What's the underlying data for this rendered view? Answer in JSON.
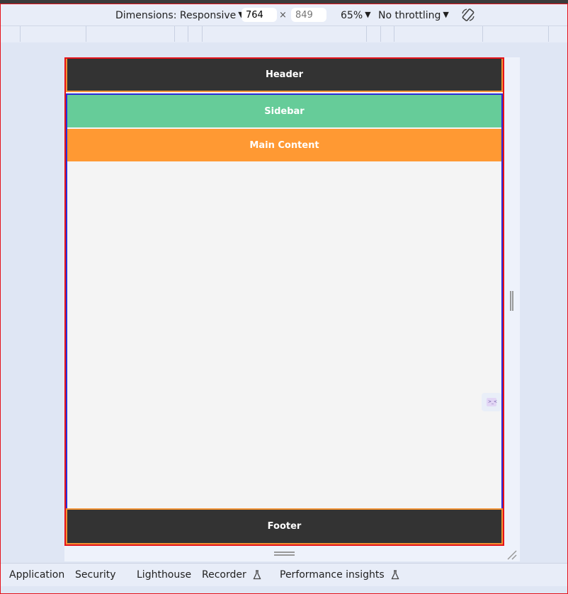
{
  "toolbar": {
    "dimensions_label": "Dimensions: Responsive",
    "width_value": "764",
    "height_placeholder": "849",
    "times_symbol": "×",
    "zoom_label": "65%",
    "throttling_label": "No throttling",
    "rotate_icon": "rotate-device-icon"
  },
  "layout_demo": {
    "header": "Header",
    "sidebar": "Sidebar",
    "main": "Main Content",
    "footer": "Footer"
  },
  "bottom_tabs": [
    {
      "label": "Application"
    },
    {
      "label": "Security"
    },
    {
      "label": "Lighthouse"
    },
    {
      "label": "Recorder",
      "icon": "flask-icon"
    },
    {
      "label": "Performance insights",
      "icon": "flask-icon"
    }
  ],
  "colors": {
    "header_bg": "#333333",
    "sidebar_bg": "#66cc99",
    "main_bg": "#ff9933",
    "outline_red": "#e5131b",
    "outline_blue": "#2b2bd9",
    "outline_orange": "#f29233"
  }
}
